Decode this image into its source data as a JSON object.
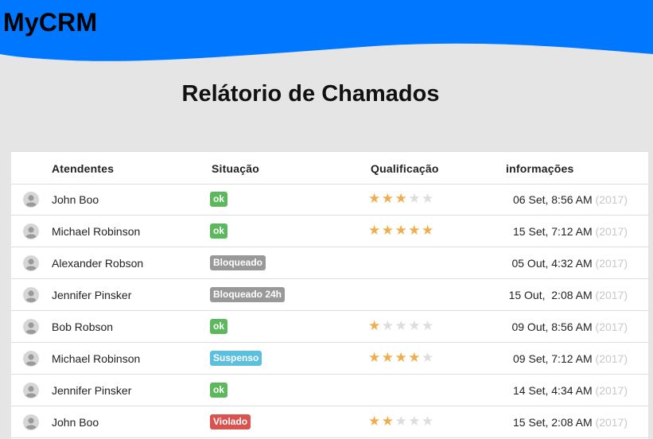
{
  "app": {
    "brand": "MyCRM"
  },
  "page": {
    "title": "Relátorio de Chamados"
  },
  "colors": {
    "header": "#0077ff",
    "ok": "#5cb85c",
    "blocked": "#999999",
    "suspended": "#5bc0de",
    "violated": "#d9534f",
    "star": "#f0ad4e"
  },
  "table": {
    "headers": {
      "agents": "Atendentes",
      "status": "Situação",
      "rating": "Qualificação",
      "info": "informações"
    },
    "rows": [
      {
        "name": "John Boo",
        "status": "ok",
        "status_type": "ok",
        "rating": 3,
        "datetime": "06 Set, 8:56 AM",
        "year": "(2017)"
      },
      {
        "name": "Michael Robinson",
        "status": "ok",
        "status_type": "ok",
        "rating": 5,
        "datetime": "15 Set, 7:12 AM",
        "year": "(2017)"
      },
      {
        "name": "Alexander Robson",
        "status": "Bloqueado",
        "status_type": "blocked",
        "rating": null,
        "datetime": "05 Out, 4:32 AM",
        "year": "(2017)"
      },
      {
        "name": "Jennifer Pinsker",
        "status": "Bloqueado 24h",
        "status_type": "blocked",
        "rating": null,
        "datetime": "15 Out,  2:08 AM",
        "year": "(2017)"
      },
      {
        "name": "Bob Robson",
        "status": "ok",
        "status_type": "ok",
        "rating": 1,
        "datetime": "09 Out, 8:56 AM",
        "year": "(2017)"
      },
      {
        "name": "Michael Robinson",
        "status": "Suspenso",
        "status_type": "suspended",
        "rating": 4,
        "datetime": "09 Set, 7:12 AM",
        "year": "(2017)"
      },
      {
        "name": "Jennifer Pinsker",
        "status": "ok",
        "status_type": "ok",
        "rating": null,
        "datetime": "14 Set, 4:34 AM",
        "year": "(2017)"
      },
      {
        "name": "John Boo",
        "status": "Violado",
        "status_type": "violated",
        "rating": 2,
        "datetime": "15 Set, 2:08 AM",
        "year": "(2017)"
      }
    ]
  }
}
